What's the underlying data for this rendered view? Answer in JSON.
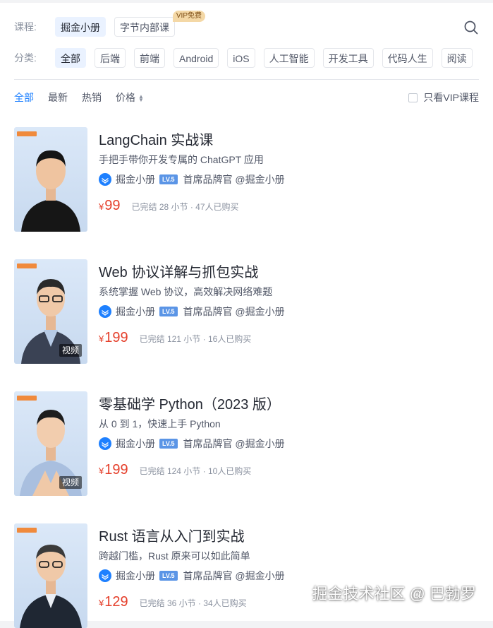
{
  "filters": {
    "course_label": "课程:",
    "course_options": [
      {
        "label": "掘金小册",
        "active": true
      },
      {
        "label": "字节内部课",
        "active": false,
        "badge": "VIP免费"
      }
    ],
    "category_label": "分类:",
    "categories": [
      {
        "label": "全部",
        "active": true
      },
      {
        "label": "后端",
        "active": false
      },
      {
        "label": "前端",
        "active": false
      },
      {
        "label": "Android",
        "active": false
      },
      {
        "label": "iOS",
        "active": false
      },
      {
        "label": "人工智能",
        "active": false
      },
      {
        "label": "开发工具",
        "active": false
      },
      {
        "label": "代码人生",
        "active": false
      },
      {
        "label": "阅读",
        "active": false
      }
    ]
  },
  "sort": {
    "items": [
      "全部",
      "最新",
      "热销",
      "价格"
    ],
    "active": "全部",
    "vip_only_label": "只看VIP课程"
  },
  "courses": [
    {
      "title": "LangChain 实战课",
      "desc": "手把手带你开发专属的 ChatGPT 应用",
      "author": "掘金小册",
      "level": "LV.5",
      "author_title": "首席品牌官 @掘金小册",
      "currency": "¥",
      "price": "99",
      "stats": "已完结 28 小节 · 47人已购买",
      "video_tag": ""
    },
    {
      "title": "Web 协议详解与抓包实战",
      "desc": "系统掌握 Web 协议，高效解决网络难题",
      "author": "掘金小册",
      "level": "LV.5",
      "author_title": "首席品牌官 @掘金小册",
      "currency": "¥",
      "price": "199",
      "stats": "已完结 121 小节 · 16人已购买",
      "video_tag": "视频"
    },
    {
      "title": "零基础学 Python（2023 版）",
      "desc": "从 0 到 1，快速上手 Python",
      "author": "掘金小册",
      "level": "LV.5",
      "author_title": "首席品牌官 @掘金小册",
      "currency": "¥",
      "price": "199",
      "stats": "已完结 124 小节 · 10人已购买",
      "video_tag": "视频"
    },
    {
      "title": "Rust 语言从入门到实战",
      "desc": "跨越门槛，Rust 原来可以如此简单",
      "author": "掘金小册",
      "level": "LV.5",
      "author_title": "首席品牌官 @掘金小册",
      "currency": "¥",
      "price": "129",
      "stats": "已完结 36 小节 · 34人已购买",
      "video_tag": ""
    }
  ],
  "watermark": "掘金技术社区 @ 巴勃罗",
  "colors": {
    "accent": "#1e80ff",
    "price": "#e5402c",
    "active_chip_bg": "#eaf2ff"
  }
}
